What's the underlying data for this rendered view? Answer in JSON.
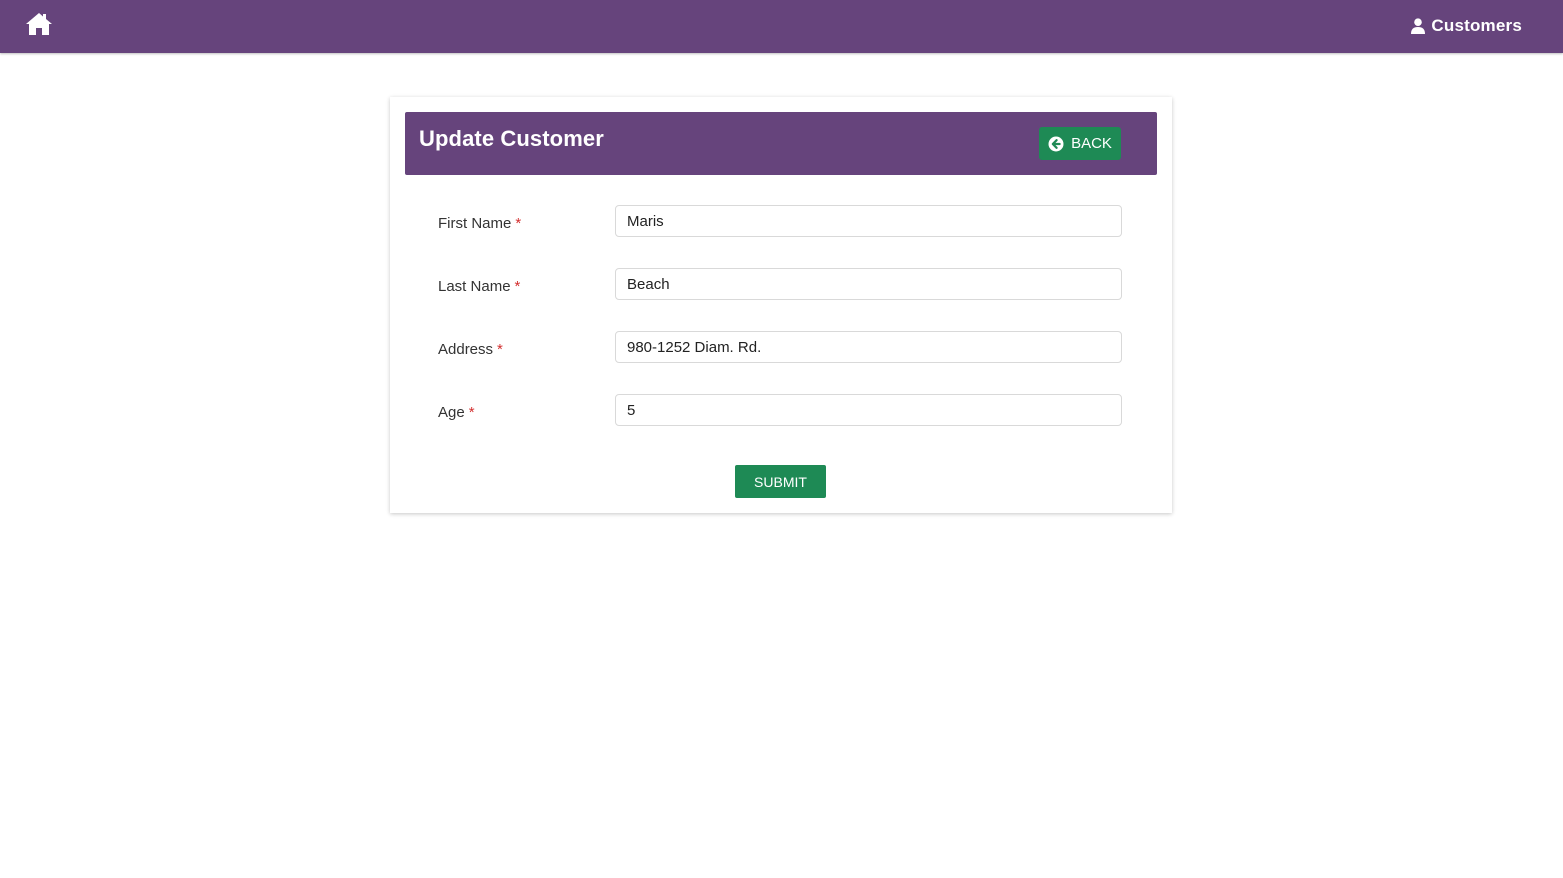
{
  "navbar": {
    "home_icon": "home-icon",
    "customers_icon": "user-icon",
    "customers_label": "Customers",
    "background": "#66447c"
  },
  "card": {
    "title": "Update Customer",
    "back_icon": "arrow-circle-left-icon",
    "back_label": "BACK",
    "accent": "#1e8a55"
  },
  "form": {
    "required_mark": "*",
    "fields": [
      {
        "label": "First Name",
        "value": "Maris"
      },
      {
        "label": "Last Name",
        "value": "Beach"
      },
      {
        "label": "Address",
        "value": "980-1252 Diam. Rd."
      },
      {
        "label": "Age",
        "value": "5"
      }
    ],
    "submit_label": "SUBMIT"
  }
}
